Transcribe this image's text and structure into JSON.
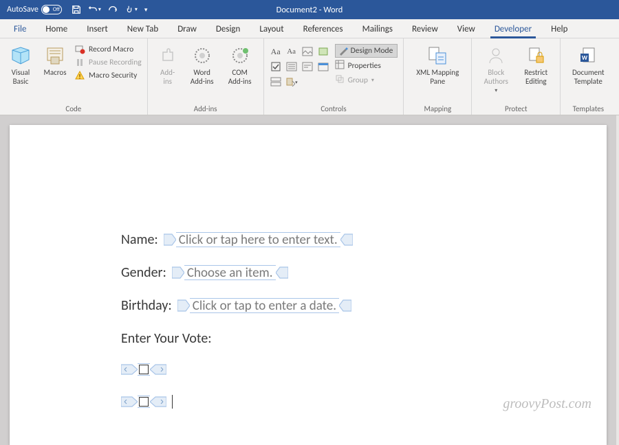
{
  "titlebar": {
    "autosave_label": "AutoSave",
    "autosave_state": "Off",
    "document_title": "Document2 - Word"
  },
  "tabs": {
    "items": [
      "File",
      "Home",
      "Insert",
      "New Tab",
      "Draw",
      "Design",
      "Layout",
      "References",
      "Mailings",
      "Review",
      "View",
      "Developer",
      "Help"
    ],
    "active": "Developer"
  },
  "ribbon": {
    "code": {
      "visual_basic": "Visual\nBasic",
      "macros": "Macros",
      "record_macro": "Record Macro",
      "pause_recording": "Pause Recording",
      "macro_security": "Macro Security",
      "label": "Code"
    },
    "addins": {
      "addins": "Add-\nins",
      "word_addins": "Word\nAdd-ins",
      "com_addins": "COM\nAdd-ins",
      "label": "Add-ins"
    },
    "controls": {
      "design_mode": "Design Mode",
      "properties": "Properties",
      "group": "Group",
      "label": "Controls"
    },
    "mapping": {
      "xml_mapping": "XML Mapping\nPane",
      "label": "Mapping"
    },
    "protect": {
      "block_authors": "Block\nAuthors",
      "restrict_editing": "Restrict\nEditing",
      "label": "Protect"
    },
    "templates": {
      "document_template": "Document\nTemplate",
      "label": "Templates"
    }
  },
  "document": {
    "fields": {
      "name_label": "Name:",
      "name_placeholder": "Click or tap here to enter text.",
      "gender_label": "Gender:",
      "gender_placeholder": "Choose an item.",
      "birthday_label": "Birthday:",
      "birthday_placeholder": "Click or tap to enter a date.",
      "vote_label": "Enter Your Vote:"
    }
  },
  "watermark": "groovyPost.com"
}
